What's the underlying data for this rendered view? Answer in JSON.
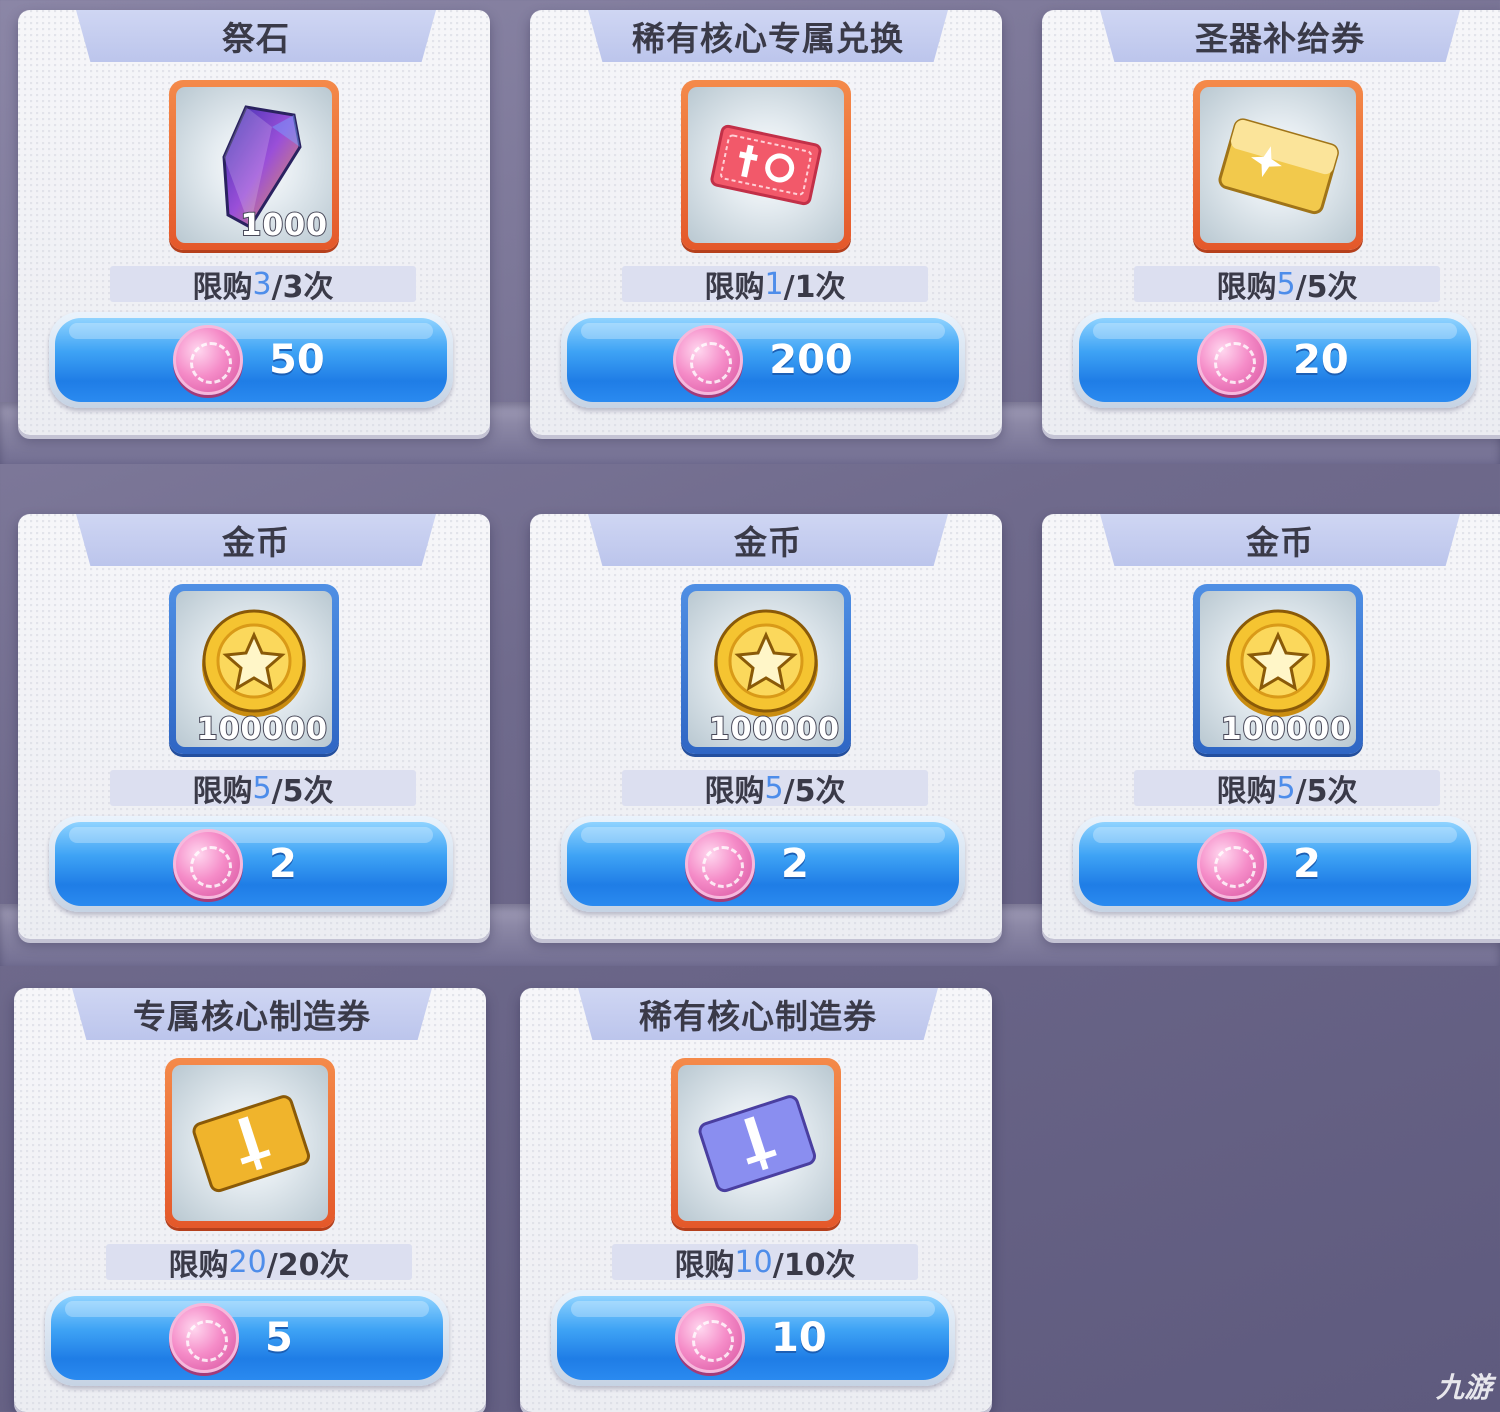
{
  "colors": {
    "remaining_count": "#4e8dea",
    "button_blue": "#2a8af0",
    "frame_orange": "#e4582a",
    "frame_blue": "#2f66c4",
    "currency_pink": "#f58cc8"
  },
  "items": [
    {
      "name": "祭石",
      "icon": "crystal-icon",
      "frame": "orange",
      "quantity": "1000",
      "limit_prefix": "限购",
      "limit_remaining": "3",
      "limit_total": "/3次",
      "price": "50"
    },
    {
      "name": "稀有核心专属兑换",
      "icon": "ticket-icon",
      "frame": "orange",
      "quantity": "",
      "limit_prefix": "限购",
      "limit_remaining": "1",
      "limit_total": "/1次",
      "price": "200"
    },
    {
      "name": "圣器补给券",
      "icon": "gold-card-icon",
      "frame": "orange",
      "quantity": "",
      "limit_prefix": "限购",
      "limit_remaining": "5",
      "limit_total": "/5次",
      "price": "20"
    },
    {
      "name": "金币",
      "icon": "gold-coin-icon",
      "frame": "blue",
      "quantity": "100000",
      "limit_prefix": "限购",
      "limit_remaining": "5",
      "limit_total": "/5次",
      "price": "2"
    },
    {
      "name": "金币",
      "icon": "gold-coin-icon",
      "frame": "blue",
      "quantity": "100000",
      "limit_prefix": "限购",
      "limit_remaining": "5",
      "limit_total": "/5次",
      "price": "2"
    },
    {
      "name": "金币",
      "icon": "gold-coin-icon",
      "frame": "blue",
      "quantity": "100000",
      "limit_prefix": "限购",
      "limit_remaining": "5",
      "limit_total": "/5次",
      "price": "2"
    },
    {
      "name": "专属核心制造券",
      "icon": "gold-sword-ticket-icon",
      "frame": "orange",
      "quantity": "",
      "limit_prefix": "限购",
      "limit_remaining": "20",
      "limit_total": "/20次",
      "price": "5"
    },
    {
      "name": "稀有核心制造券",
      "icon": "purple-sword-ticket-icon",
      "frame": "orange",
      "quantity": "",
      "limit_prefix": "限购",
      "limit_remaining": "10",
      "limit_total": "/10次",
      "price": "10"
    }
  ],
  "currency_icon": "pink-currency-coin-icon",
  "watermark": "九游"
}
